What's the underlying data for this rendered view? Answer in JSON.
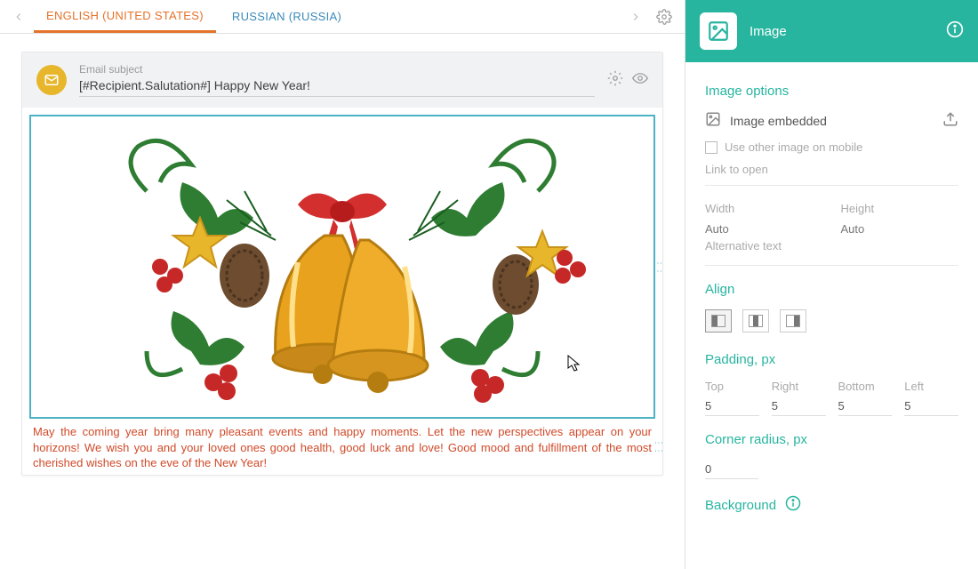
{
  "tabs": {
    "active": "ENGLISH (UNITED STATES)",
    "inactive": "RUSSIAN (RUSSIA)"
  },
  "subject": {
    "label": "Email subject",
    "value": "[#Recipient.Salutation#] Happy New Year!"
  },
  "body_text": "May the coming year bring many pleasant events and happy moments. Let the new perspectives appear on your horizons! We wish you and your loved ones good health, good luck and love! Good mood and fulfillment of the most cherished wishes on the eve of the New Year!",
  "side": {
    "title": "Image",
    "section_options": "Image options",
    "image_embedded": "Image embedded",
    "use_other_mobile": "Use other image on mobile",
    "link_to_open": "Link to open",
    "width_label": "Width",
    "width_value": "Auto",
    "height_label": "Height",
    "height_value": "Auto",
    "alt_label": "Alternative text",
    "align_label": "Align",
    "padding_label": "Padding, px",
    "pad_top_label": "Top",
    "pad_top": "5",
    "pad_right_label": "Right",
    "pad_right": "5",
    "pad_bottom_label": "Bottom",
    "pad_bottom": "5",
    "pad_left_label": "Left",
    "pad_left": "5",
    "corner_label": "Corner radius, px",
    "corner_value": "0",
    "background_label": "Background"
  }
}
